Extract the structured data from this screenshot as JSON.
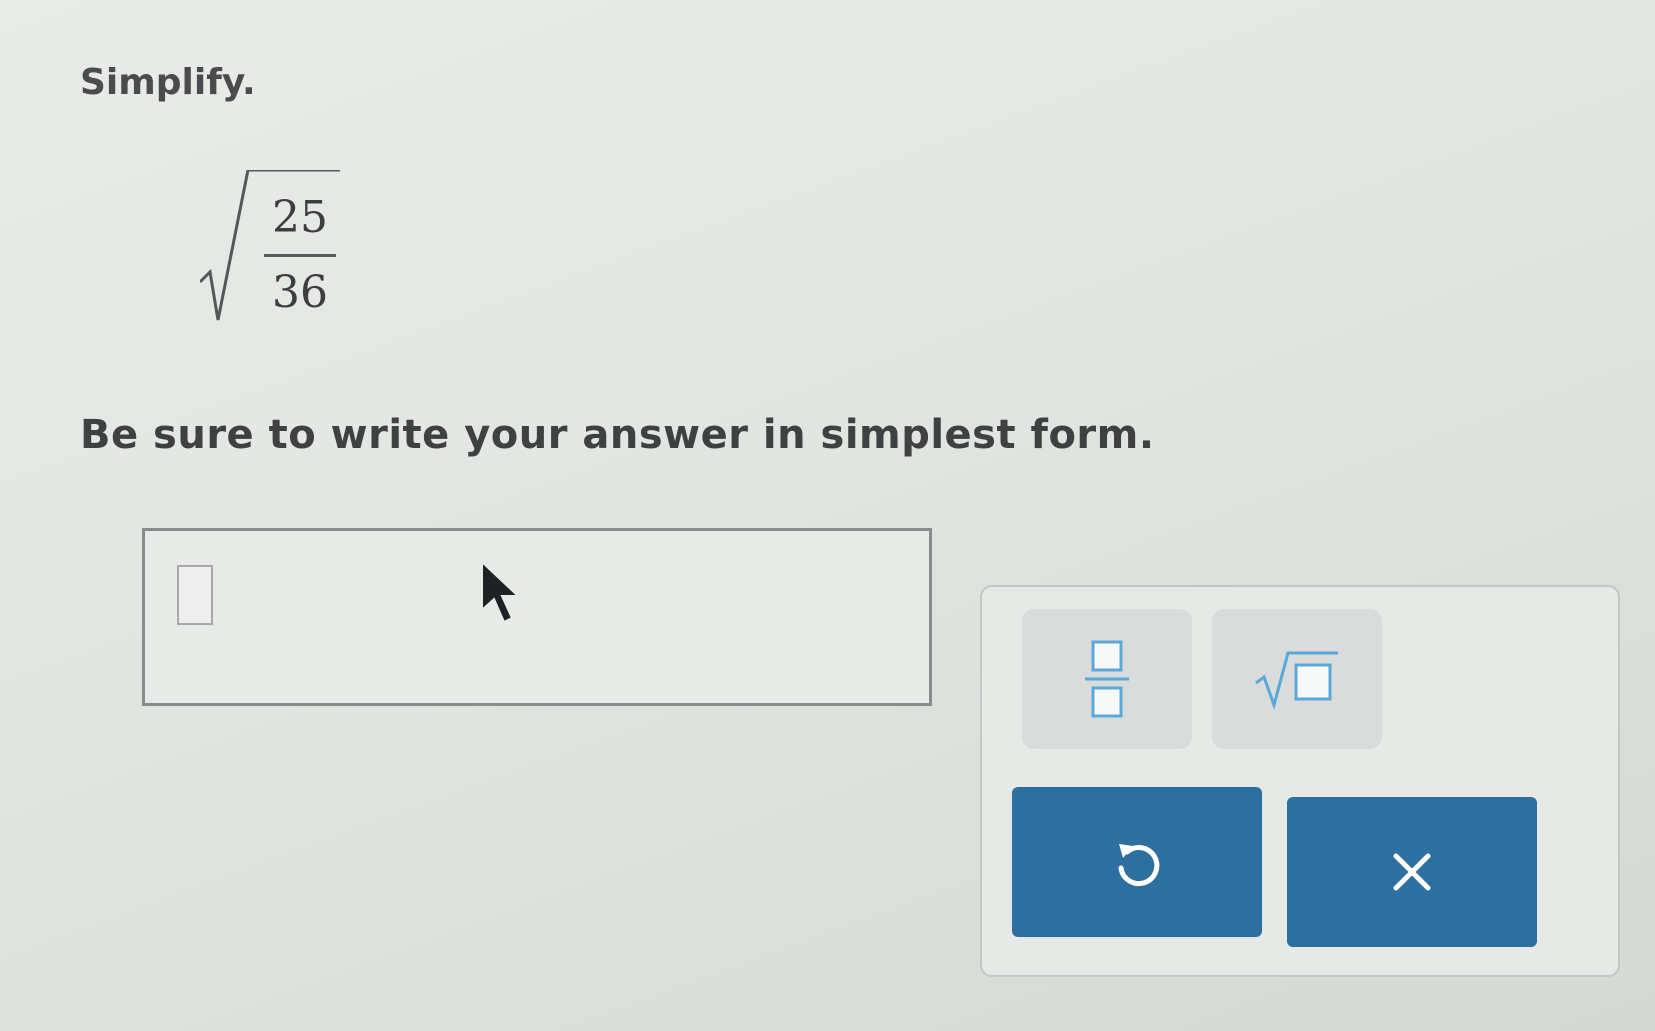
{
  "question": {
    "label": "Simplify.",
    "expression": {
      "numerator": "25",
      "denominator": "36"
    },
    "instruction": "Be sure to write your answer in simplest form."
  },
  "answer": {
    "value": ""
  },
  "keypad": {
    "fraction_icon": "fraction-template-icon",
    "sqrt_icon": "square-root-template-icon",
    "undo_icon": "undo-icon",
    "clear_icon": "clear-x-icon"
  },
  "colors": {
    "action_button": "#2d6f9e",
    "template_button": "#d9dcdb",
    "template_glyph": "#5aa8d8"
  }
}
